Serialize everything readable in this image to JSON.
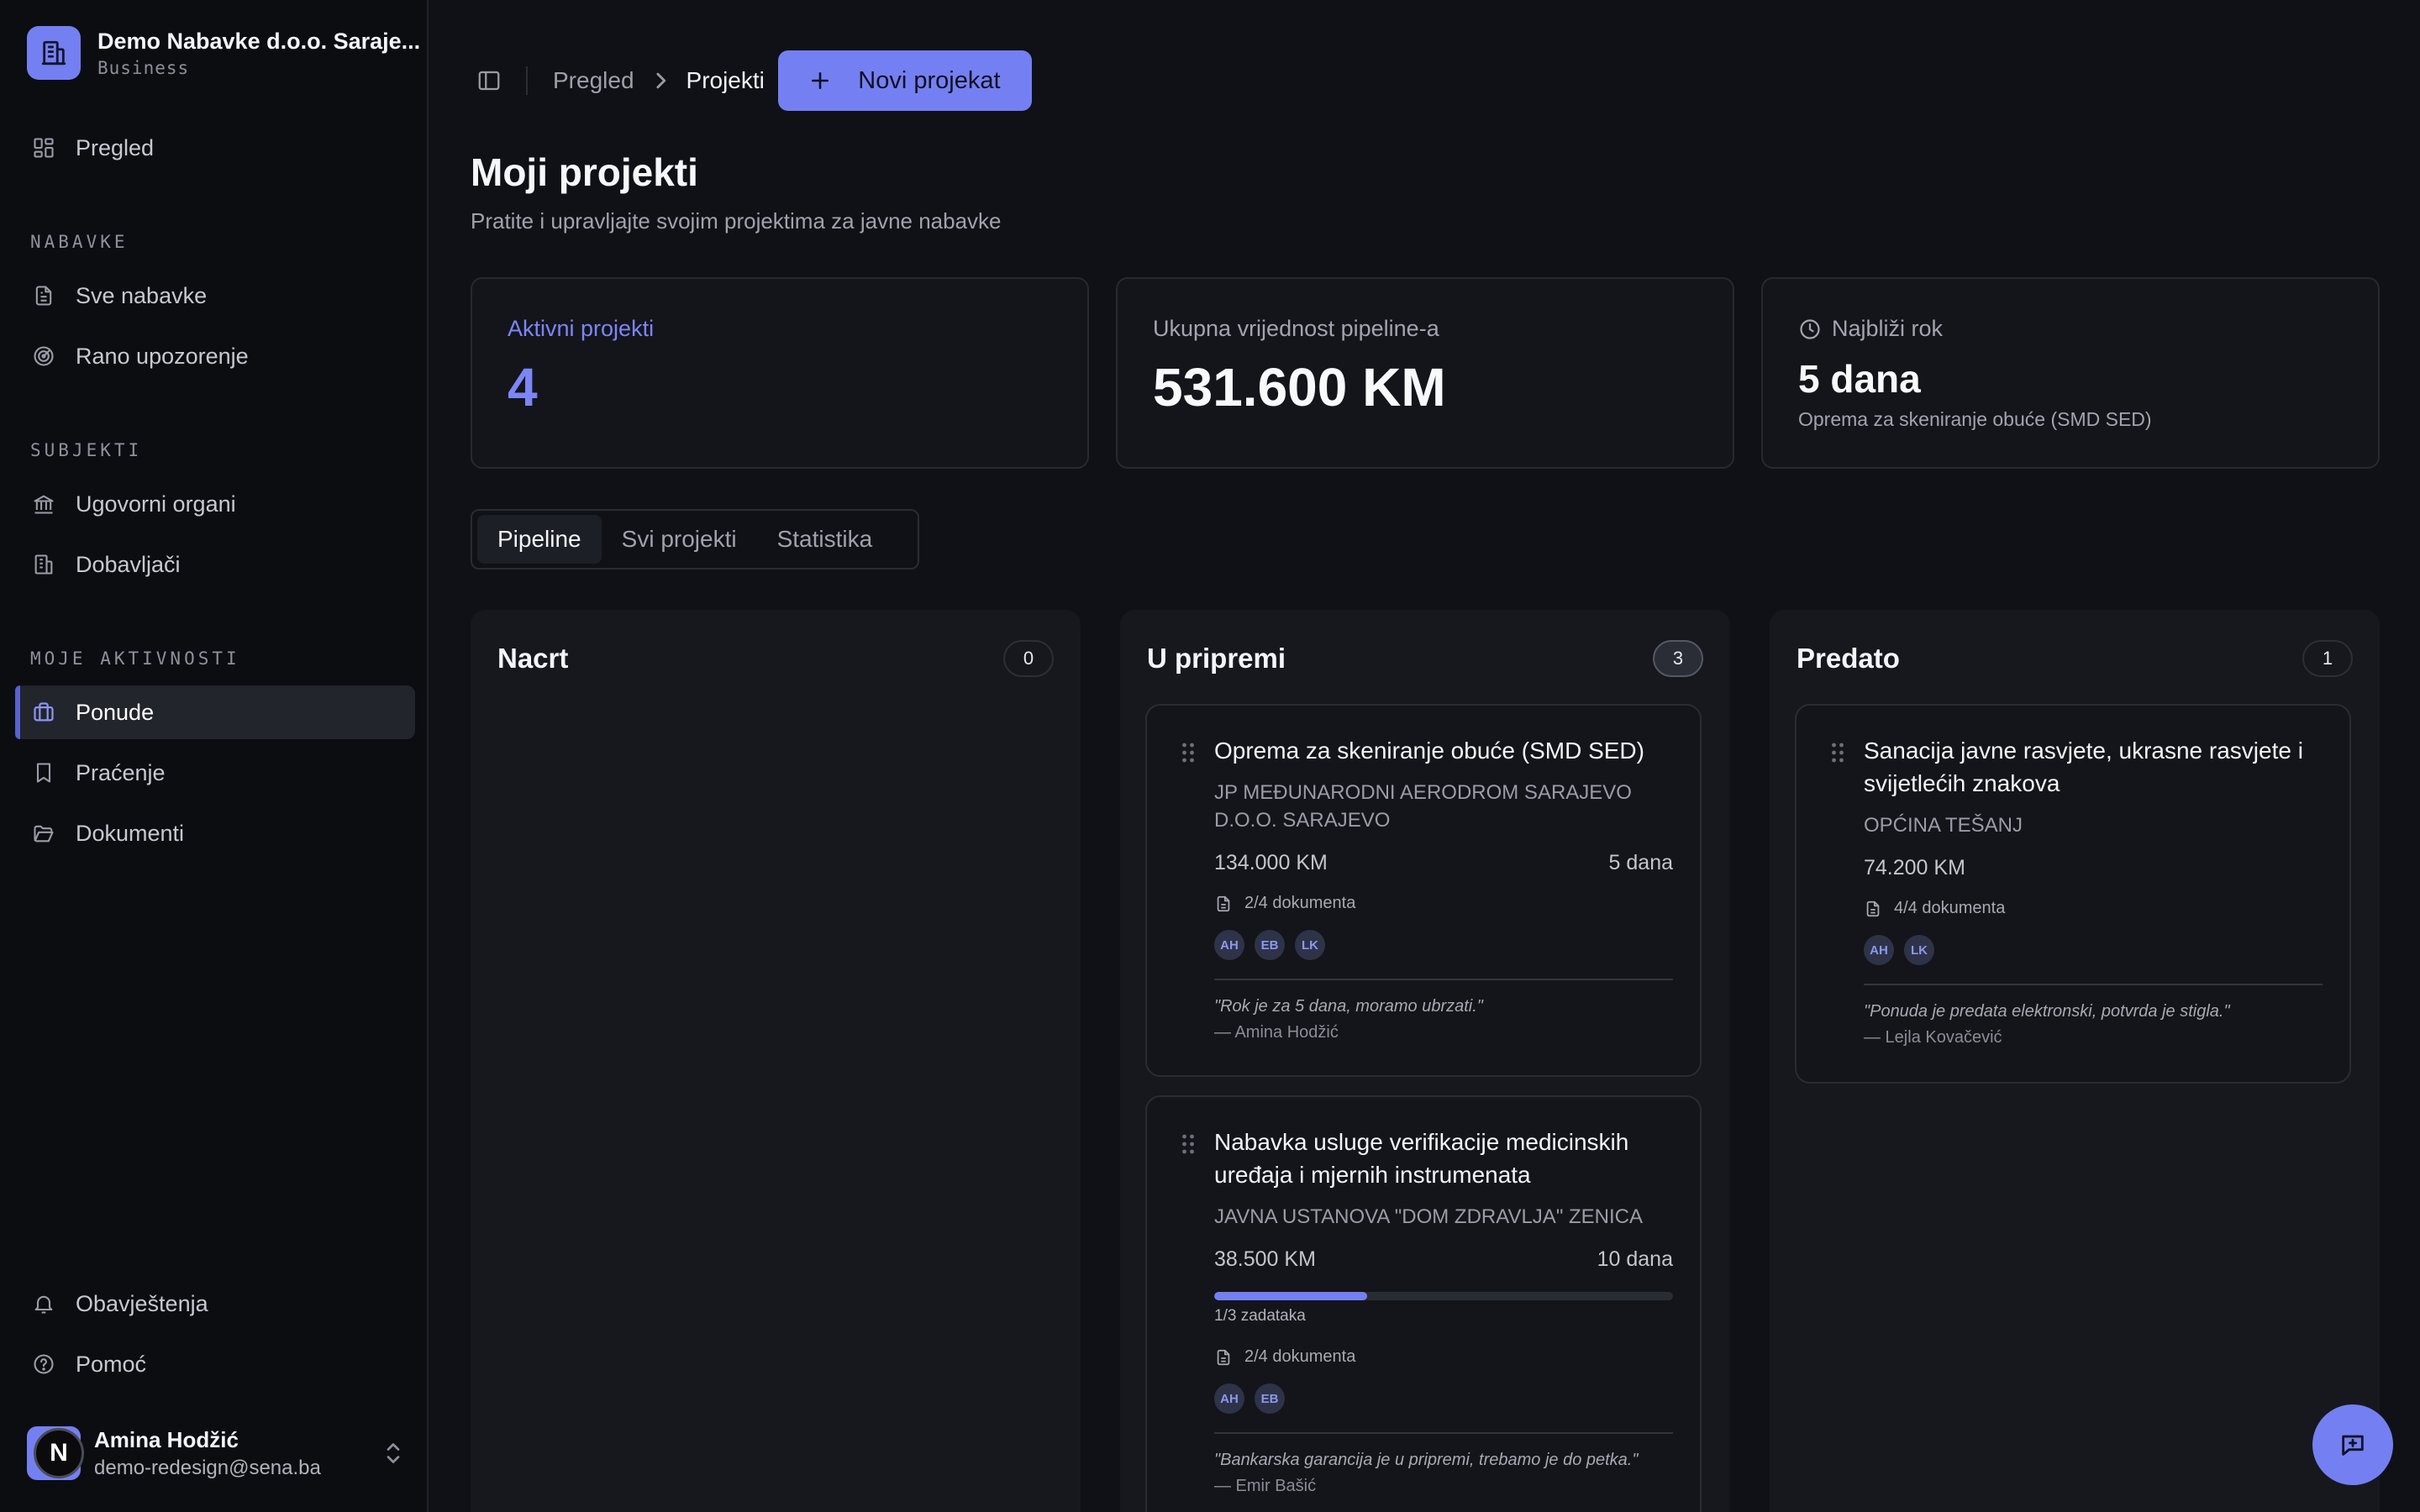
{
  "org": {
    "name": "Demo Nabavke d.o.o. Saraje...",
    "plan": "Business"
  },
  "nav": {
    "overview": "Pregled",
    "section_procurements": "NABAVKE",
    "all_procurements": "Sve nabavke",
    "early_warning": "Rano upozorenje",
    "section_subjects": "SUBJEKTI",
    "contracting_authorities": "Ugovorni organi",
    "suppliers": "Dobavljači",
    "section_activities": "MOJE AKTIVNOSTI",
    "bids": "Ponude",
    "tracking": "Praćenje",
    "documents": "Dokumenti",
    "notifications": "Obavještenja",
    "help": "Pomoć"
  },
  "user": {
    "name": "Amina Hodžić",
    "email": "demo-redesign@sena.ba",
    "badge": "N"
  },
  "breadcrumb": {
    "parent": "Pregled",
    "current": "Projekti"
  },
  "toolbar": {
    "new_project": "Novi projekat"
  },
  "page": {
    "title": "Moji projekti",
    "subtitle": "Pratite i upravljajte svojim projektima za javne nabavke"
  },
  "stats": {
    "active_label": "Aktivni projekti",
    "active_value": "4",
    "pipeline_label": "Ukupna vrijednost pipeline-a",
    "pipeline_value": "531.600 KM",
    "deadline_label": "Najbliži rok",
    "deadline_value": "5 dana",
    "deadline_project": "Oprema za skeniranje obuće (SMD SED)"
  },
  "tabs": [
    "Pipeline",
    "Svi projekti",
    "Statistika"
  ],
  "columns": [
    {
      "title": "Nacrt",
      "count": "0"
    },
    {
      "title": "U pripremi",
      "count": "3"
    },
    {
      "title": "Predato",
      "count": "1"
    }
  ],
  "cards": {
    "prep1": {
      "title": "Oprema za skeniranje obuće (SMD SED)",
      "org": "JP MEĐUNARODNI AERODROM SARAJEVO D.O.O. SARAJEVO",
      "value": "134.000 KM",
      "deadline": "5 dana",
      "docs": "2/4 dokumenta",
      "avatars": [
        "AH",
        "EB",
        "LK"
      ],
      "quote": "\"Rok je za 5 dana, moramo ubrzati.\"",
      "author": "— Amina Hodžić"
    },
    "prep2": {
      "title": "Nabavka usluge verifikacije medicinskih uređaja i mjernih instrumenata",
      "org": "JAVNA USTANOVA \"DOM ZDRAVLJA\" ZENICA",
      "value": "38.500 KM",
      "deadline": "10 dana",
      "progress": 0.333,
      "progress_label": "1/3 zadataka",
      "docs": "2/4 dokumenta",
      "avatars": [
        "AH",
        "EB"
      ],
      "quote": "\"Bankarska garancija je u pripremi, trebamo je do petka.\"",
      "author": "— Emir Bašić"
    },
    "sub1": {
      "title": "Sanacija javne rasvjete, ukrasne rasvjete i svijetlećih znakova",
      "org": "OPĆINA TEŠANJ",
      "value": "74.200 KM",
      "docs": "4/4 dokumenta",
      "avatars": [
        "AH",
        "LK"
      ],
      "quote": "\"Ponuda je predata elektronski, potvrda je stigla.\"",
      "author": "— Lejla Kovačević"
    }
  },
  "colors": {
    "accent": "#7480f2",
    "background": "#101116",
    "sidebar": "#0c0d11"
  }
}
